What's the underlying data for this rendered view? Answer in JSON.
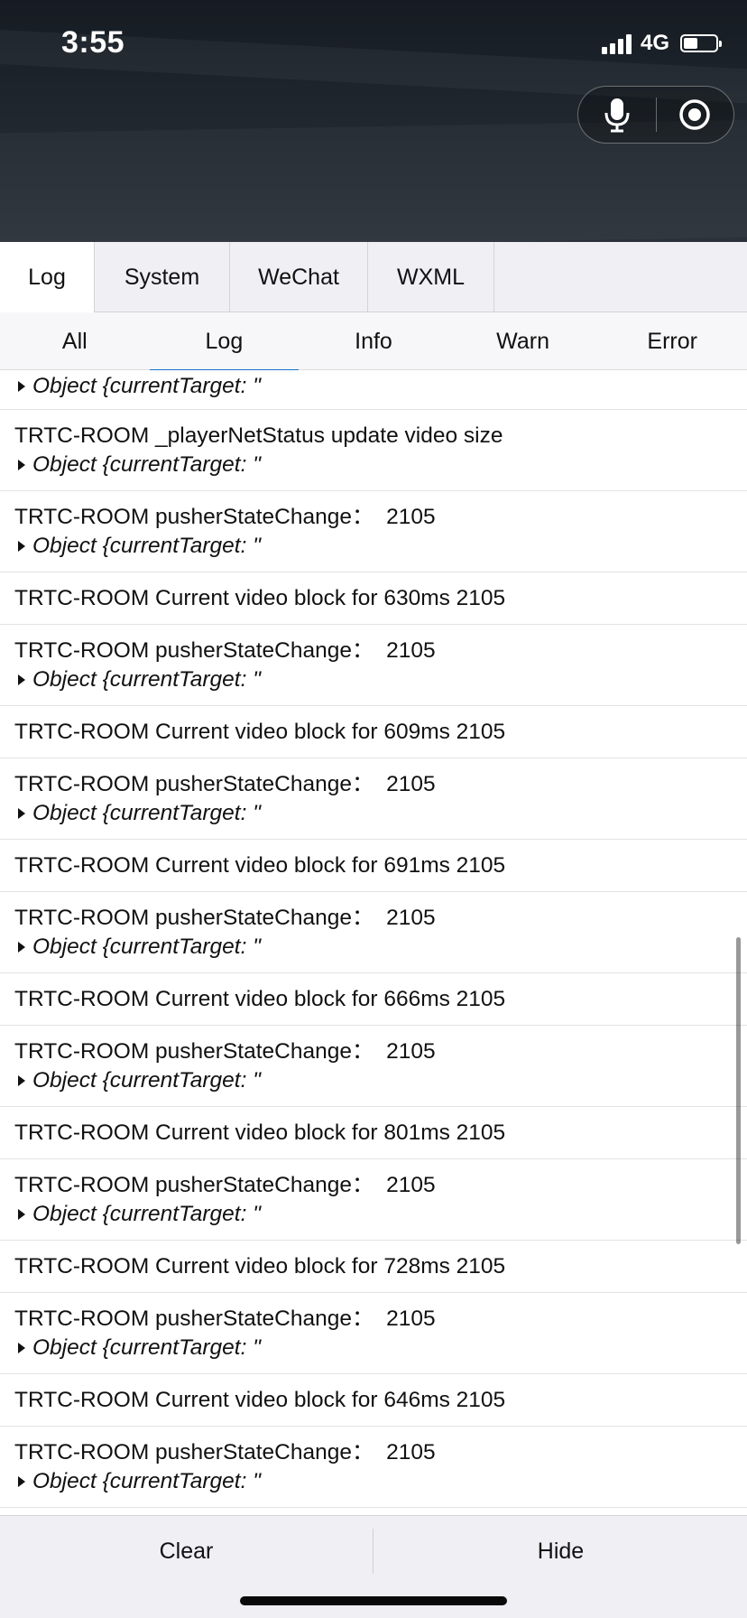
{
  "status_bar": {
    "time": "3:55",
    "network": "4G",
    "battery_level": 0.45
  },
  "capsule": {
    "mic_icon": "microphone-icon",
    "record_icon": "record-target-icon"
  },
  "main_tabs": [
    {
      "label": "Log",
      "active": true
    },
    {
      "label": "System",
      "active": false
    },
    {
      "label": "WeChat",
      "active": false
    },
    {
      "label": "WXML",
      "active": false
    }
  ],
  "filter_tabs": [
    {
      "label": "All",
      "active": false
    },
    {
      "label": "Log",
      "active": true
    },
    {
      "label": "Info",
      "active": false
    },
    {
      "label": "Warn",
      "active": false
    },
    {
      "label": "Error",
      "active": false
    }
  ],
  "logs": [
    {
      "text": "",
      "object": "Object {currentTarget: \""
    },
    {
      "text": "TRTC-ROOM _playerNetStatus update video size",
      "object": "Object {currentTarget: \""
    },
    {
      "text": "TRTC-ROOM pusherStateChange：  2105",
      "object": "Object {currentTarget: \""
    },
    {
      "text": "TRTC-ROOM Current video block for 630ms 2105",
      "object": ""
    },
    {
      "text": "TRTC-ROOM pusherStateChange：  2105",
      "object": "Object {currentTarget: \""
    },
    {
      "text": "TRTC-ROOM Current video block for 609ms 2105",
      "object": ""
    },
    {
      "text": "TRTC-ROOM pusherStateChange：  2105",
      "object": "Object {currentTarget: \""
    },
    {
      "text": "TRTC-ROOM Current video block for 691ms 2105",
      "object": ""
    },
    {
      "text": "TRTC-ROOM pusherStateChange：  2105",
      "object": "Object {currentTarget: \""
    },
    {
      "text": "TRTC-ROOM Current video block for 666ms 2105",
      "object": ""
    },
    {
      "text": "TRTC-ROOM pusherStateChange：  2105",
      "object": "Object {currentTarget: \""
    },
    {
      "text": "TRTC-ROOM Current video block for 801ms 2105",
      "object": ""
    },
    {
      "text": "TRTC-ROOM pusherStateChange：  2105",
      "object": "Object {currentTarget: \""
    },
    {
      "text": "TRTC-ROOM Current video block for 728ms 2105",
      "object": ""
    },
    {
      "text": "TRTC-ROOM pusherStateChange：  2105",
      "object": "Object {currentTarget: \""
    },
    {
      "text": "TRTC-ROOM Current video block for 646ms 2105",
      "object": ""
    },
    {
      "text": "TRTC-ROOM pusherStateChange：  2105",
      "object": "Object {currentTarget: \""
    }
  ],
  "bottom_bar": {
    "clear_label": "Clear",
    "hide_label": "Hide"
  }
}
